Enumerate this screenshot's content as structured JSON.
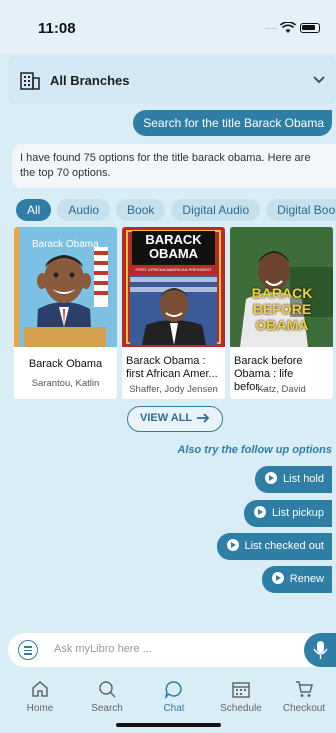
{
  "status": {
    "time": "11:08"
  },
  "branch": {
    "title": "All Branches"
  },
  "chat": {
    "user_query": "Search for the title Barack Obama",
    "bot_reply": "I have found 75 options for the title barack obama. Here are the top 70 options."
  },
  "filters": [
    "All",
    "Audio",
    "Book",
    "Digital Audio",
    "Digital Book"
  ],
  "books": [
    {
      "title": "Barack Obama",
      "author": "Sarantou, Katlin",
      "cover_text": "Barack Obama"
    },
    {
      "title": "Barack Obama : first African Amer...",
      "author": "Shaffer, Jody Jensen",
      "cover_text": "BARACK OBAMA",
      "cover_subtext": "FIRST AFRICAN AMERICAN PRESIDENT"
    },
    {
      "title": "Barack before Obama : life befor...",
      "author": "Katz, David",
      "cover_text": "BARACK BEFORE OBAMA"
    }
  ],
  "view_all": "VIEW ALL",
  "followup": {
    "heading": "Also try the follow up options",
    "options": [
      "List hold",
      "List pickup",
      "List checked out",
      "Renew"
    ]
  },
  "input": {
    "placeholder": "Ask myLibro here ..."
  },
  "tabs": [
    {
      "label": "Home",
      "icon": "home-icon"
    },
    {
      "label": "Search",
      "icon": "search-icon"
    },
    {
      "label": "Chat",
      "icon": "chat-icon"
    },
    {
      "label": "Schedule",
      "icon": "calendar-icon"
    },
    {
      "label": "Checkout",
      "icon": "cart-icon"
    }
  ],
  "colors": {
    "accent": "#2f7ea6",
    "background": "#d9edf6"
  }
}
